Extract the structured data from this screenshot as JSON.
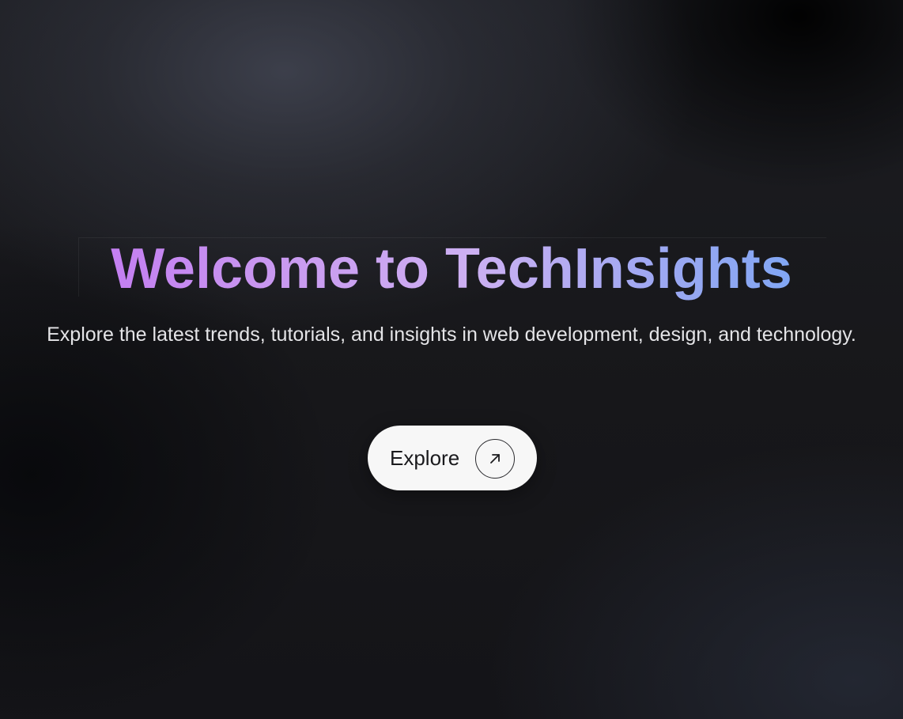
{
  "hero": {
    "title": "Welcome to TechInsights",
    "subtitle": "Explore the latest trends, tutorials, and insights in web development, design, and technology.",
    "cta": {
      "label": "Explore",
      "icon": "arrow-up-right-icon"
    }
  },
  "colors": {
    "title_gradient_start": "#c06ef2",
    "title_gradient_mid": "#cdb0f2",
    "title_gradient_end": "#6aa6f5",
    "background": "#151518",
    "button_background": "#f7f7f7",
    "button_text": "#1a1a1d",
    "subtitle_text": "#e4e4e7"
  }
}
